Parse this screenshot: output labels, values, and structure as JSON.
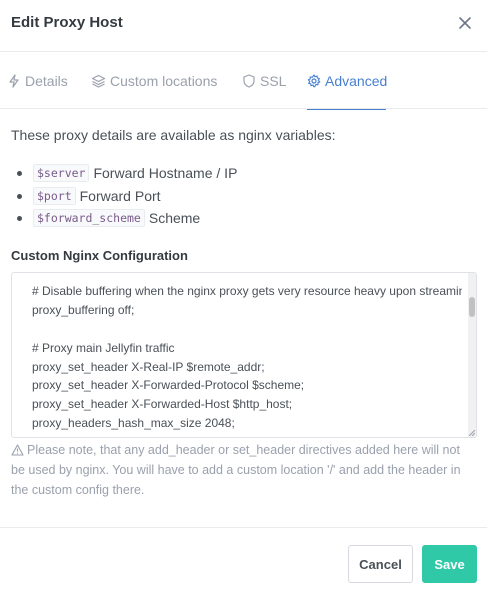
{
  "modal": {
    "title": "Edit Proxy Host",
    "close_icon": "close-icon"
  },
  "tabs": [
    {
      "label": "Details",
      "icon": "bolt-icon",
      "active": false
    },
    {
      "label": "Custom locations",
      "icon": "layers-icon",
      "active": false
    },
    {
      "label": "SSL",
      "icon": "shield-icon",
      "active": false
    },
    {
      "label": "Advanced",
      "icon": "gear-icon",
      "active": true
    }
  ],
  "advanced": {
    "intro": "These proxy details are available as nginx variables:",
    "variables": [
      {
        "code": "$server",
        "desc": "Forward Hostname / IP"
      },
      {
        "code": "$port",
        "desc": "Forward Port"
      },
      {
        "code": "$forward_scheme",
        "desc": "Scheme"
      }
    ],
    "config_label": "Custom Nginx Configuration",
    "config_lines": [
      "# Disable buffering when the nginx proxy gets very resource heavy upon streaming",
      "proxy_buffering off;",
      "",
      "# Proxy main Jellyfin traffic",
      "proxy_set_header X-Real-IP $remote_addr;",
      "proxy_set_header X-Forwarded-Protocol $scheme;",
      "proxy_set_header X-Forwarded-Host $http_host;",
      "proxy_headers_hash_max_size 2048;"
    ],
    "note": "Please note, that any add_header or set_header directives added here will not be used by nginx. You will have to add a custom location '/' and add the header in the custom config there."
  },
  "footer": {
    "cancel_label": "Cancel",
    "save_label": "Save"
  },
  "colors": {
    "accent": "#467fcf",
    "save": "#2fc9a7",
    "muted": "#9aa0ac"
  }
}
